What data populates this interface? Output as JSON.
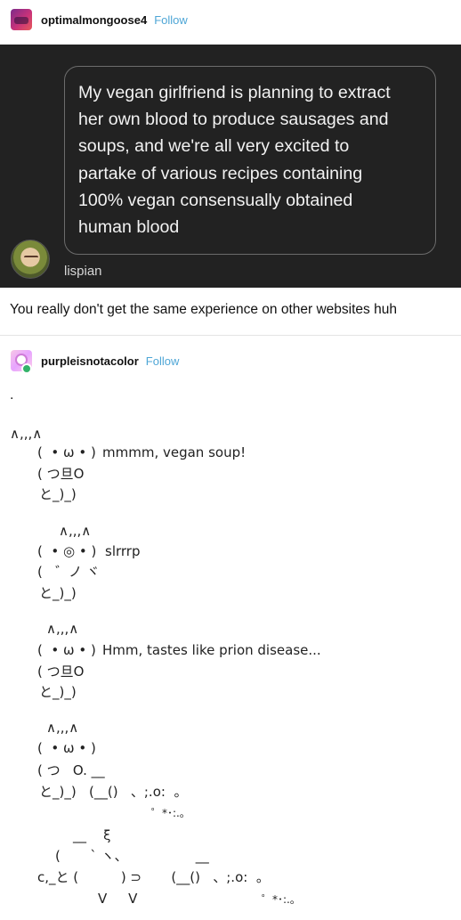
{
  "post1": {
    "username": "optimalmongoose4",
    "follow_label": "Follow",
    "screenshot": {
      "quote": "My vegan girlfriend is planning to extract her own blood to produce sausages and soups, and we're all very excited to partake of various recipes containing 100% vegan consensually obtained human blood",
      "quote_lines": [
        "My vegan girlfriend is planning to extract",
        "her own blood to produce sausages and",
        "soups, and we're all very excited to",
        "partake of various recipes containing",
        "100% vegan consensually obtained",
        "human blood"
      ],
      "author": "lispian"
    },
    "comment": "You really don't get the same experience on other websites huh"
  },
  "post2": {
    "username": "purpleisnotacolor",
    "follow_label": "Follow",
    "dot": ".",
    "art": {
      "ears_top": "∧,,,∧",
      "s1_face": "(  • ω • )",
      "s1_text": "mmmm, vegan soup!",
      "s1_arms": "( つ旦O",
      "s1_base": "と_)_)",
      "s2_ears": "∧,,,∧",
      "s2_face": "(  • ◎ • )",
      "s2_text": "slrrrp",
      "s2_arms": "(   ゛ノ ヾ",
      "s2_base": "と_)_)",
      "s3_ears": "∧,,,∧",
      "s3_face": "(  • ω • )",
      "s3_text": "Hmm, tastes like prion disease...",
      "s3_arms": "( つ旦O",
      "s3_base": "と_)_)",
      "s4_ears": "∧,,,∧",
      "s4_face": "(  • ω • )",
      "s4_arms": "( つ   O. __",
      "s4_base": "と_)_)   (__()   、;.o:  。",
      "s4_splash": "゜*･:.｡",
      "s5_line1": "__    ξ",
      "s5_line2": "(       ` ヽ、                __",
      "s5_line3": "c,_と (          ) ⊃       (__()   、;.o:  。",
      "s5_line4": "V     V",
      "s5_splash": "゜*･:.｡"
    }
  }
}
